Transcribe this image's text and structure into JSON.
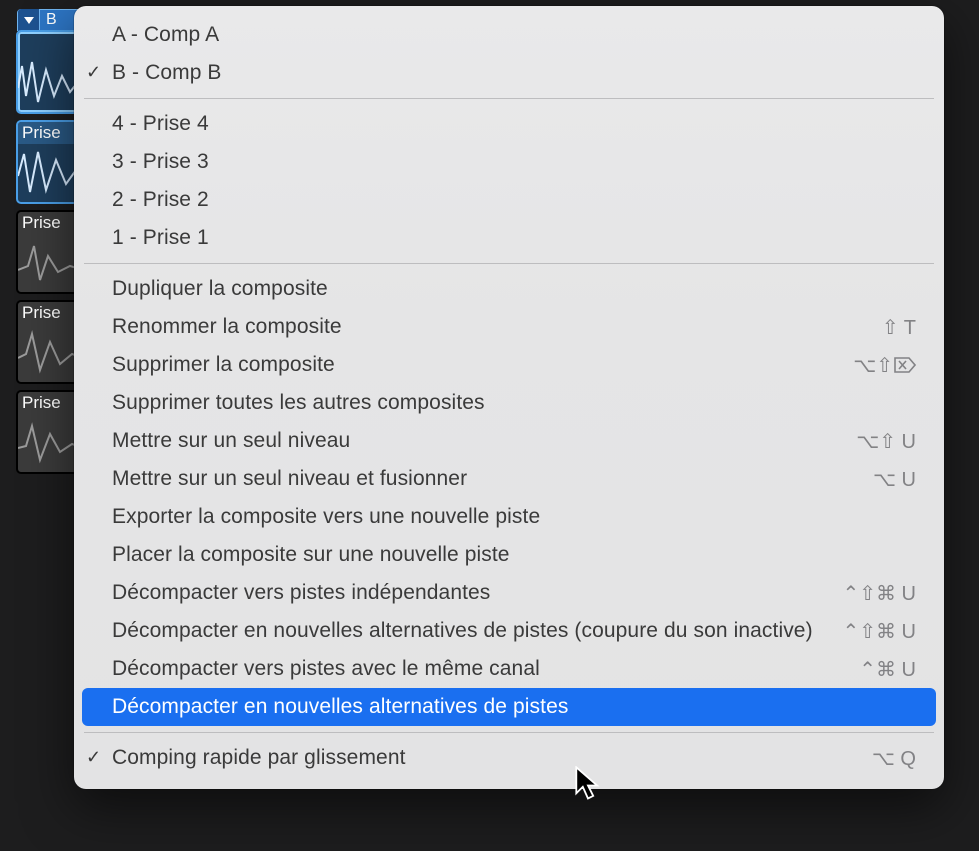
{
  "take_folder_header": "B",
  "track_labels": [
    "Prise",
    "Prise",
    "Prise",
    "Prise"
  ],
  "menu": {
    "comps": [
      {
        "label": "A - Comp A",
        "checked": false
      },
      {
        "label": "B - Comp B",
        "checked": true
      }
    ],
    "takes": [
      {
        "label": "4 - Prise 4"
      },
      {
        "label": "3 - Prise 3"
      },
      {
        "label": "2 - Prise 2"
      },
      {
        "label": "1 - Prise 1"
      }
    ],
    "actions": [
      {
        "label": "Dupliquer la composite",
        "shortcut": ""
      },
      {
        "label": "Renommer la composite",
        "shortcut": "⇧ T"
      },
      {
        "label": "Supprimer la composite",
        "shortcut": "⌥⇧ ⌦"
      },
      {
        "label": "Supprimer toutes les autres composites",
        "shortcut": ""
      },
      {
        "label": "Mettre sur un seul niveau",
        "shortcut": "⌥⇧ U"
      },
      {
        "label": "Mettre sur un seul niveau et fusionner",
        "shortcut": "⌥ U"
      },
      {
        "label": "Exporter la composite vers une nouvelle piste",
        "shortcut": ""
      },
      {
        "label": "Placer la composite sur une nouvelle piste",
        "shortcut": ""
      },
      {
        "label": "Décompacter vers pistes indépendantes",
        "shortcut": "⌃⇧⌘ U"
      },
      {
        "label": "Décompacter en nouvelles alternatives de pistes (coupure du son inactive)",
        "shortcut": "⌃⇧⌘ U"
      },
      {
        "label": "Décompacter vers pistes avec le même canal",
        "shortcut": "⌃⌘ U"
      },
      {
        "label": "Décompacter en nouvelles alternatives de pistes",
        "shortcut": "",
        "highlight": true
      }
    ],
    "footer": {
      "label": "Comping rapide par glissement",
      "shortcut": "⌥ Q",
      "checked": true
    }
  }
}
